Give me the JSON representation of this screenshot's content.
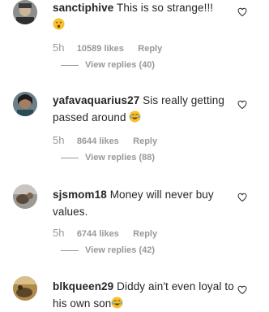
{
  "comments": [
    {
      "username": "sanctiphive",
      "text": "This is so strange!!!",
      "emoji": "astonished-face-emoji",
      "time": "5h",
      "likes": "10589 likes",
      "reply_label": "Reply",
      "view_replies": "View replies (40)"
    },
    {
      "username": "yafavaquarius27",
      "text": "Sis really getting passed around",
      "emoji": "tears-of-joy-emoji",
      "time": "5h",
      "likes": "8644 likes",
      "reply_label": "Reply",
      "view_replies": "View replies (88)"
    },
    {
      "username": "sjsmom18",
      "text": "Money will never buy values.",
      "time": "5h",
      "likes": "6744 likes",
      "reply_label": "Reply",
      "view_replies": "View replies (42)"
    },
    {
      "username": "blkqueen29",
      "text": "Diddy ain't even loyal to his own son",
      "emoji": "tears-of-joy-emoji"
    }
  ],
  "colors": {
    "text": "#262626",
    "muted": "#999999",
    "emoji_face": "#f9c02e"
  }
}
